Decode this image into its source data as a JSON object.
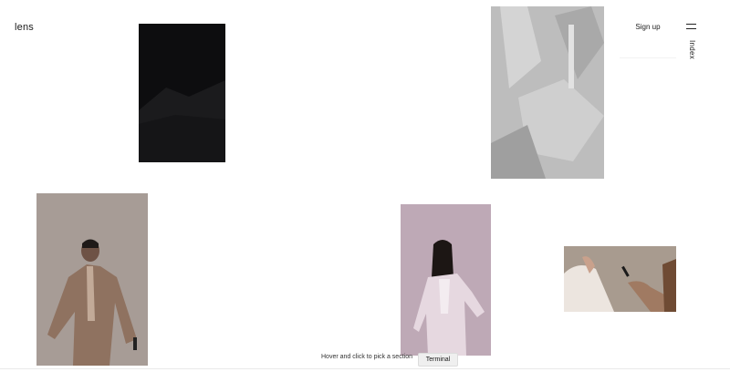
{
  "header": {
    "logo": "lens",
    "signup_label": "Sign up",
    "menu_icon": "hamburger-icon",
    "index_label": "Index"
  },
  "gallery": {
    "tiles": [
      {
        "name": "dark-abstract-photo",
        "icon": "image"
      },
      {
        "name": "grey-abstract-photo",
        "icon": "image"
      },
      {
        "name": "man-walking-photo",
        "icon": "image"
      },
      {
        "name": "woman-suit-photo",
        "icon": "image"
      },
      {
        "name": "hands-close-up-photo",
        "icon": "image"
      }
    ]
  },
  "footer": {
    "hint": "Hover and click to pick a section",
    "section_label": "Terminal"
  },
  "colors": {
    "background": "#ffffff",
    "text": "#1a1a1a",
    "pill": "#efefef"
  }
}
